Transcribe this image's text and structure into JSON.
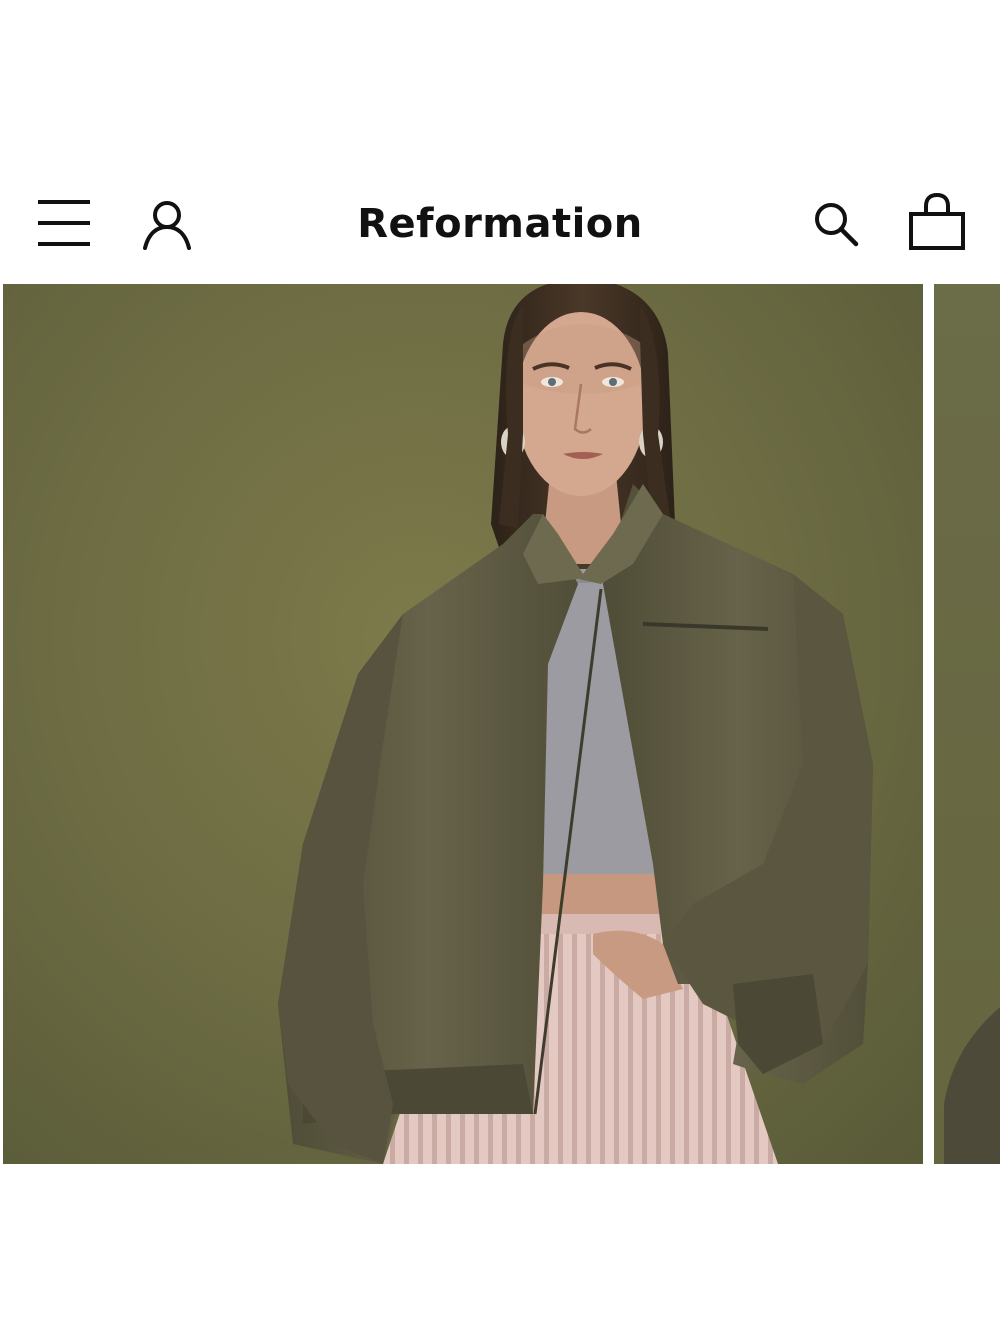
{
  "header": {
    "brand": "Reformation",
    "icons": {
      "menu": "hamburger-menu-icon",
      "account": "user-account-icon",
      "search": "search-icon",
      "bag": "shopping-bag-icon"
    }
  },
  "hero_carousel": {
    "slides": [
      {
        "description": "model-olive-zip-jacket-grey-tee-pink-cords"
      },
      {
        "description": "partial-next-image"
      }
    ]
  },
  "colors": {
    "background": "#ffffff",
    "text": "#111111",
    "backdrop": "#6d6c43",
    "jacket": "#5e5a42",
    "tee": "#9b9aa0",
    "pants": "#e2c7c0"
  }
}
